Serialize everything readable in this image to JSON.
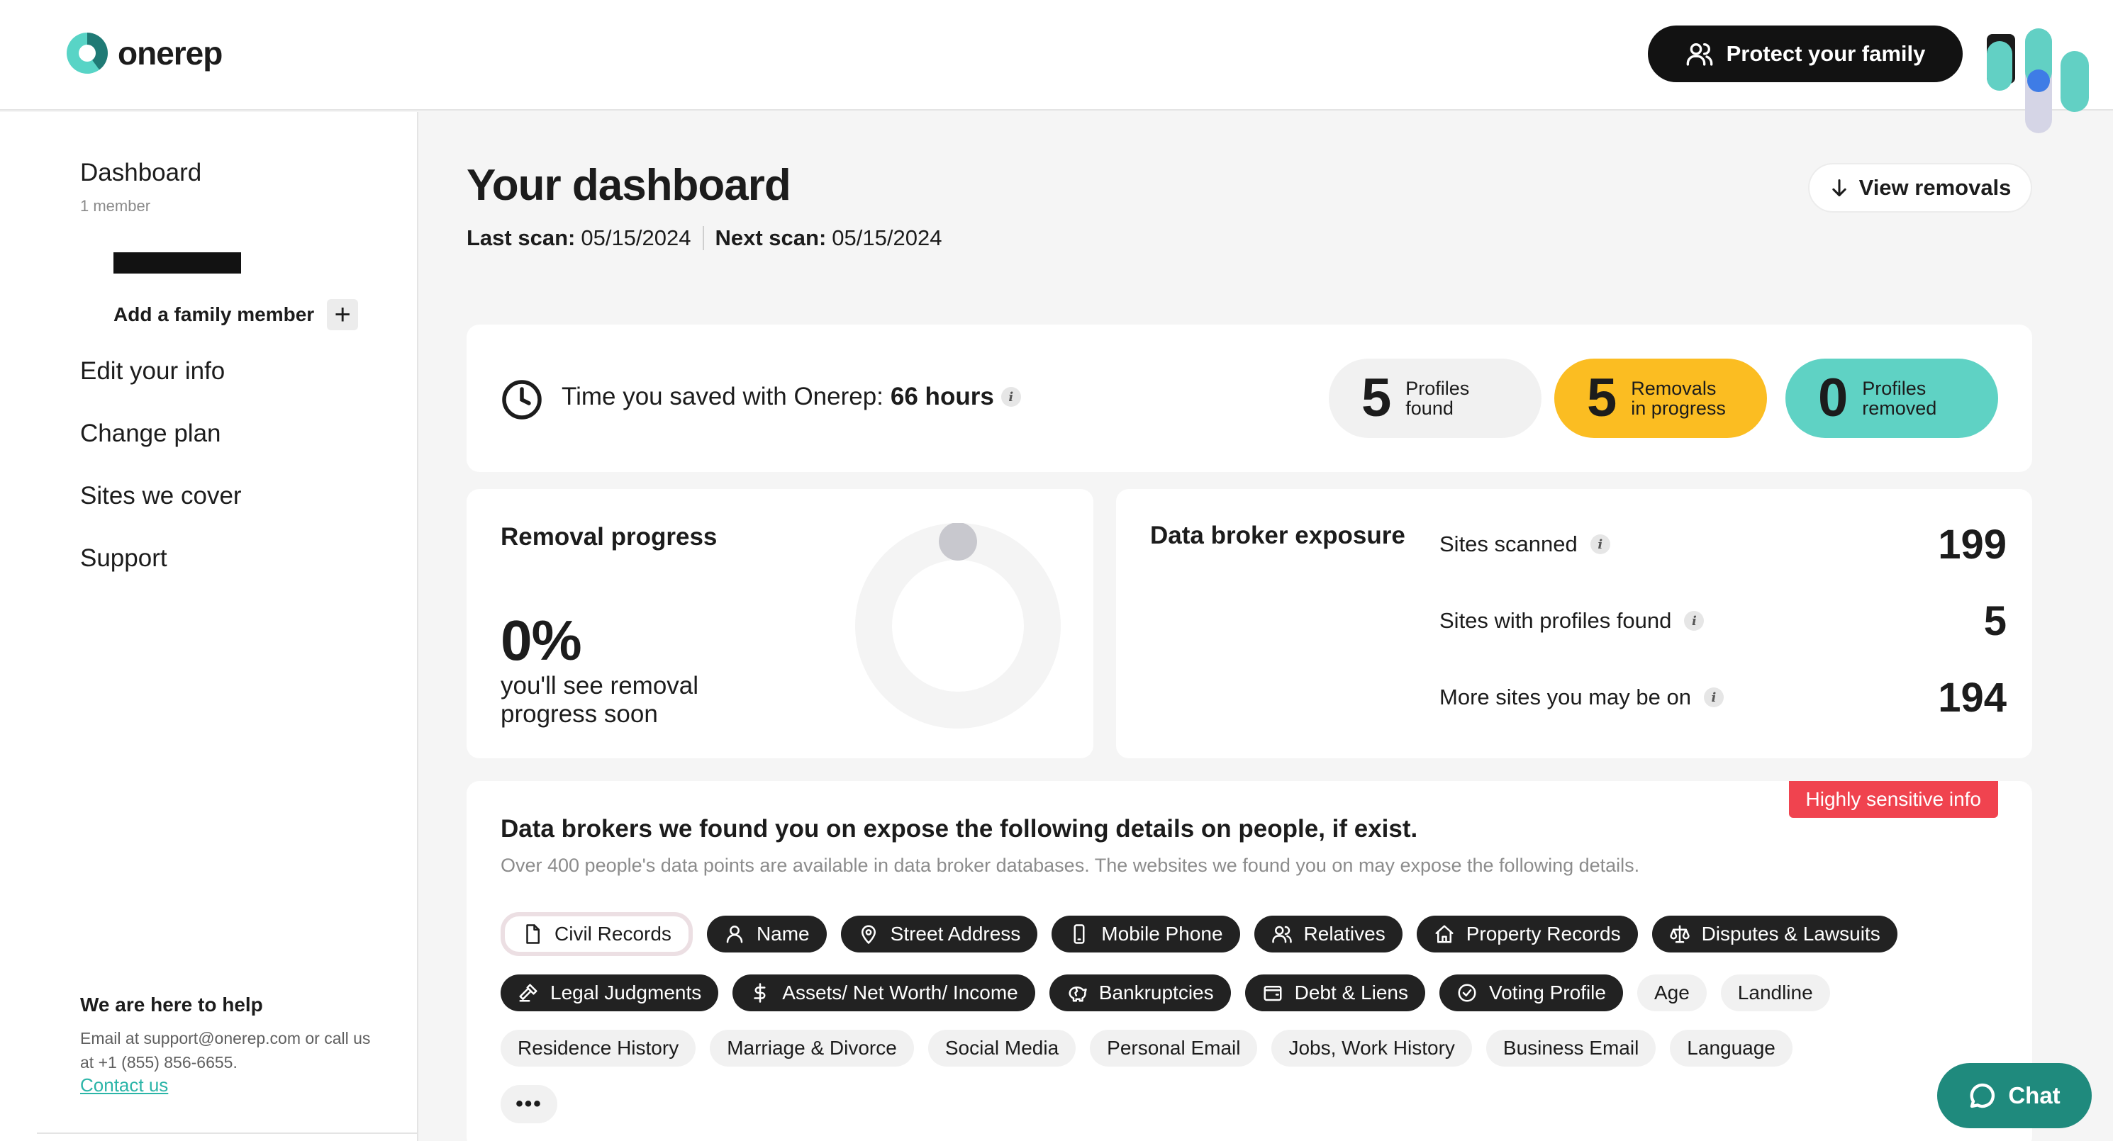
{
  "header": {
    "brand": "onerep",
    "protect_label": "Protect your family",
    "icons": {
      "logo": "onerep-logo",
      "family": "users-icon",
      "widget": "accessibility-widget-icon"
    }
  },
  "sidebar": {
    "dashboard_label": "Dashboard",
    "member_count": "1 member",
    "add_member_label": "Add a family member",
    "add_member_icon": "+",
    "links": [
      "Edit your info",
      "Change plan",
      "Sites we cover",
      "Support"
    ],
    "help": {
      "title": "We are here to help",
      "text": "Email at support@onerep.com or call us at +1 (855) 856-6655.",
      "link": "Contact us"
    }
  },
  "main": {
    "title": "Your dashboard",
    "last_scan_label": "Last scan:",
    "last_scan_value": "05/15/2024",
    "next_scan_label": "Next scan:",
    "next_scan_value": "05/15/2024",
    "view_removals_label": "View removals"
  },
  "time_saved": {
    "label": "Time you saved with Onerep:",
    "value": "66 hours",
    "info": "i",
    "stats": [
      {
        "num": "5",
        "line1": "Profiles",
        "line2": "found",
        "color": "#f1f1f1"
      },
      {
        "num": "5",
        "line1": "Removals",
        "line2": "in progress",
        "color": "#fbbd22"
      },
      {
        "num": "0",
        "line1": "Profiles",
        "line2": "removed",
        "color": "#5fd2c4"
      }
    ]
  },
  "removal_progress": {
    "title": "Removal progress",
    "percent": "0%",
    "percent_value": 0,
    "note": "you'll see removal progress soon"
  },
  "exposure": {
    "title": "Data broker exposure",
    "rows": [
      {
        "label": "Sites scanned",
        "value": "199"
      },
      {
        "label": "Sites with profiles found",
        "value": "5"
      },
      {
        "label": "More sites you may be on",
        "value": "194"
      }
    ]
  },
  "brokers": {
    "badge": "Highly sensitive info",
    "title": "Data brokers we found you on expose the following details on people, if exist.",
    "subtitle": "Over 400 people's data points are available in data broker databases. The websites we found you on may expose the following details.",
    "chips_row1": [
      {
        "label": "Civil Records",
        "icon": "document-icon"
      },
      {
        "label": "Name",
        "icon": "user-icon"
      },
      {
        "label": "Street Address",
        "icon": "map-pin-icon"
      },
      {
        "label": "Mobile Phone",
        "icon": "mobile-icon"
      },
      {
        "label": "Relatives",
        "icon": "users-icon"
      },
      {
        "label": "Property Records",
        "icon": "home-icon"
      },
      {
        "label": "Disputes & Lawsuits",
        "icon": "scales-icon"
      }
    ],
    "chips_row2_dark": [
      {
        "label": "Legal Judgments",
        "icon": "gavel-icon"
      },
      {
        "label": "Assets/ Net Worth/ Income",
        "icon": "dollar-icon"
      },
      {
        "label": "Bankruptcies",
        "icon": "broken-piggy-icon"
      },
      {
        "label": "Debt & Liens",
        "icon": "wallet-icon"
      },
      {
        "label": "Voting Profile",
        "icon": "check-circle-icon"
      }
    ],
    "chips_row2_light": [
      "Age",
      "Landline"
    ],
    "chips_row3": [
      "Residence History",
      "Marriage & Divorce",
      "Social Media",
      "Personal Email",
      "Jobs, Work History",
      "Business Email",
      "Language"
    ],
    "more": "•••"
  },
  "chat_label": "Chat"
}
